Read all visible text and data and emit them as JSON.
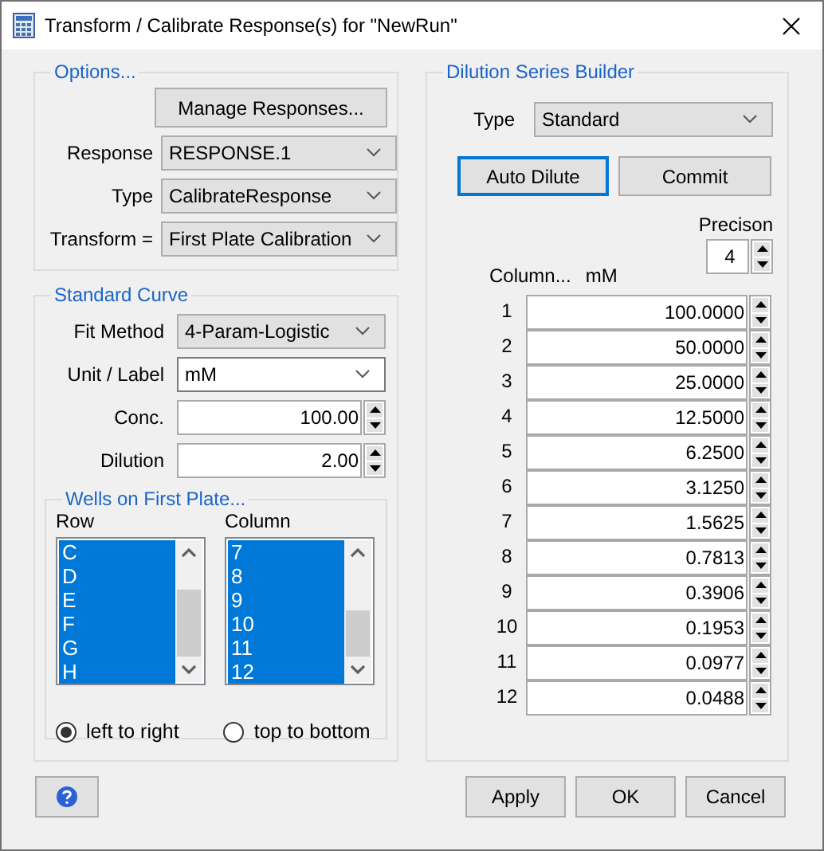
{
  "window": {
    "title": "Transform / Calibrate Response(s) for \"NewRun\""
  },
  "options": {
    "legend": "Options...",
    "manage_button": "Manage Responses...",
    "fields": [
      {
        "label": "Response",
        "value": "RESPONSE.1"
      },
      {
        "label": "Type",
        "value": "CalibrateResponse"
      },
      {
        "label": "Transform =",
        "value": "First Plate Calibration"
      }
    ]
  },
  "standard_curve": {
    "legend": "Standard Curve",
    "fields": [
      {
        "kind": "dropdown",
        "label": "Fit Method",
        "value": "4-Param-Logistic"
      },
      {
        "kind": "editable-dropdown",
        "label": "Unit / Label",
        "value": "mM"
      },
      {
        "kind": "spin",
        "label": "Conc.",
        "value": "100.00"
      },
      {
        "kind": "spin",
        "label": "Dilution",
        "value": "2.00"
      }
    ],
    "wells": {
      "legend": "Wells on First Plate...",
      "lists": [
        {
          "header": "Row",
          "items": [
            {
              "text": "C",
              "selected": true
            },
            {
              "text": "D",
              "selected": true
            },
            {
              "text": "E",
              "selected": true
            },
            {
              "text": "F",
              "selected": true
            },
            {
              "text": "G",
              "selected": true
            },
            {
              "text": "H",
              "selected": true
            }
          ]
        },
        {
          "header": "Column",
          "items": [
            {
              "text": "7",
              "selected": true
            },
            {
              "text": "8",
              "selected": true
            },
            {
              "text": "9",
              "selected": true
            },
            {
              "text": "10",
              "selected": true
            },
            {
              "text": "11",
              "selected": true
            },
            {
              "text": "12",
              "selected": true
            }
          ]
        }
      ],
      "order": [
        {
          "label": "left to right",
          "selected": true
        },
        {
          "label": "top to bottom",
          "selected": false
        }
      ]
    }
  },
  "dilution": {
    "legend": "Dilution Series Builder",
    "type": {
      "label": "Type",
      "value": "Standard"
    },
    "buttons": [
      {
        "label": "Auto Dilute",
        "focused": true
      },
      {
        "label": "Commit",
        "focused": false
      }
    ],
    "precision": {
      "label": "Precison",
      "value": "4"
    },
    "column_header": "Column...",
    "unit": "mM",
    "rows": [
      {
        "column": "1",
        "value": "100.0000"
      },
      {
        "column": "2",
        "value": "50.0000"
      },
      {
        "column": "3",
        "value": "25.0000"
      },
      {
        "column": "4",
        "value": "12.5000"
      },
      {
        "column": "5",
        "value": "6.2500"
      },
      {
        "column": "6",
        "value": "3.1250"
      },
      {
        "column": "7",
        "value": "1.5625"
      },
      {
        "column": "8",
        "value": "0.7813"
      },
      {
        "column": "9",
        "value": "0.3906"
      },
      {
        "column": "10",
        "value": "0.1953"
      },
      {
        "column": "11",
        "value": "0.0977"
      },
      {
        "column": "12",
        "value": "0.0488"
      }
    ]
  },
  "footer": {
    "buttons": [
      "Apply",
      "OK",
      "Cancel"
    ]
  }
}
